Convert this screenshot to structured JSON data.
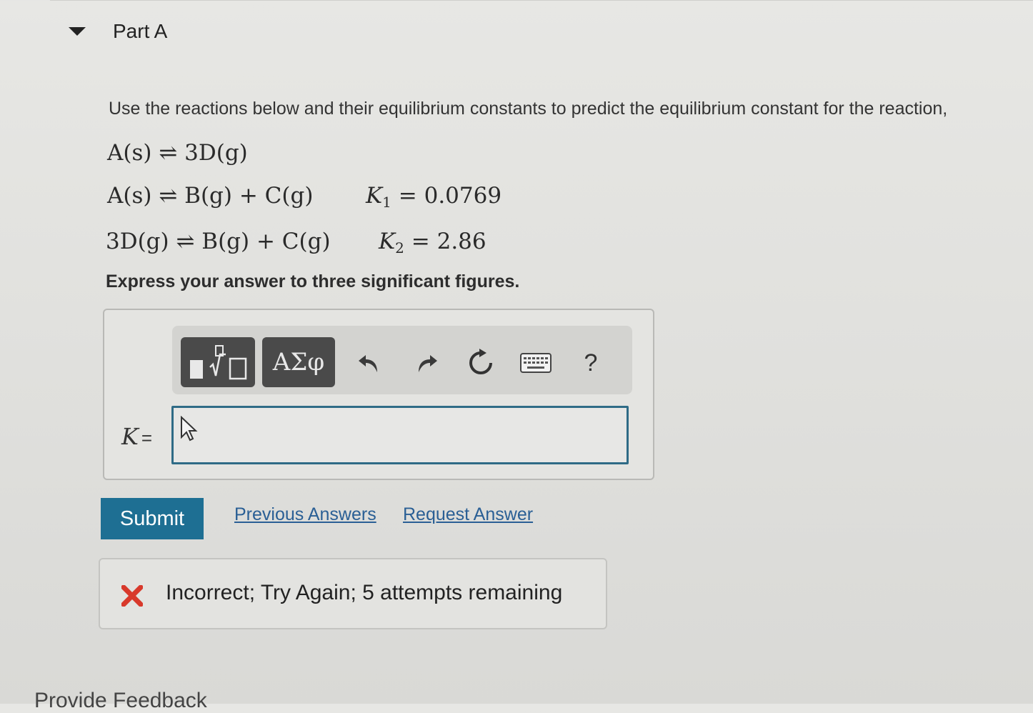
{
  "part": {
    "title": "Part A"
  },
  "question": {
    "instructions": "Use the reactions below and their equilibrium constants to predict the equilibrium constant for the reaction,",
    "target_reaction": "A(s) ⇌ 3D(g)",
    "reactions": [
      {
        "equation": "A(s) ⇌ B(g) + C(g)",
        "k_symbol": "K",
        "k_sub": "1",
        "k_value": "= 0.0769"
      },
      {
        "equation": "3D(g) ⇌ B(g) + C(g)",
        "k_symbol": "K",
        "k_sub": "2",
        "k_value": "= 2.86"
      }
    ],
    "express": "Express your answer to three significant figures."
  },
  "toolbar": {
    "greek_label": "ΑΣφ",
    "help_label": "?",
    "icons": [
      "templates-icon",
      "greek-symbols-icon",
      "undo-icon",
      "redo-icon",
      "reset-icon",
      "keyboard-icon",
      "help-icon"
    ]
  },
  "answer": {
    "variable": "K",
    "equals": "=",
    "value": ""
  },
  "actions": {
    "submit_label": "Submit",
    "previous_answers_label": "Previous Answers",
    "request_answer_label": "Request Answer"
  },
  "feedback": {
    "message": "Incorrect; Try Again; 5 attempts remaining",
    "status_color": "#d8392b"
  },
  "colors": {
    "accent": "#1e6f93",
    "link": "#2a5f95",
    "input_border": "#2f6b86"
  },
  "footer": {
    "partial_text": "Provide Feedback"
  }
}
